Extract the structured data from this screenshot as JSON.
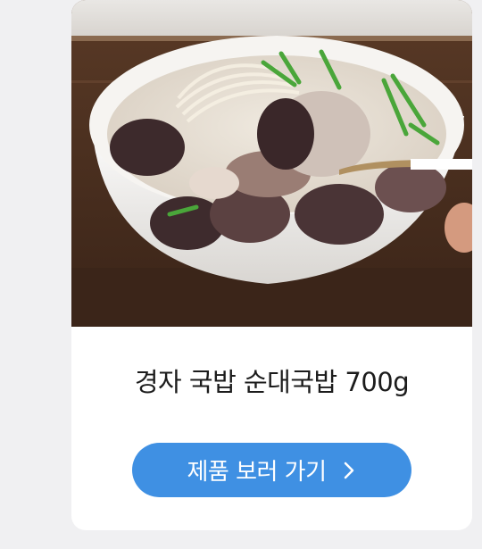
{
  "product": {
    "name": "경자 국밥 순대국밥 700g",
    "image_icon": "soup-bowl-photo"
  },
  "cta": {
    "label": "제품 보러 가기",
    "icon": "chevron-right-icon",
    "color": "#3f90e3"
  }
}
